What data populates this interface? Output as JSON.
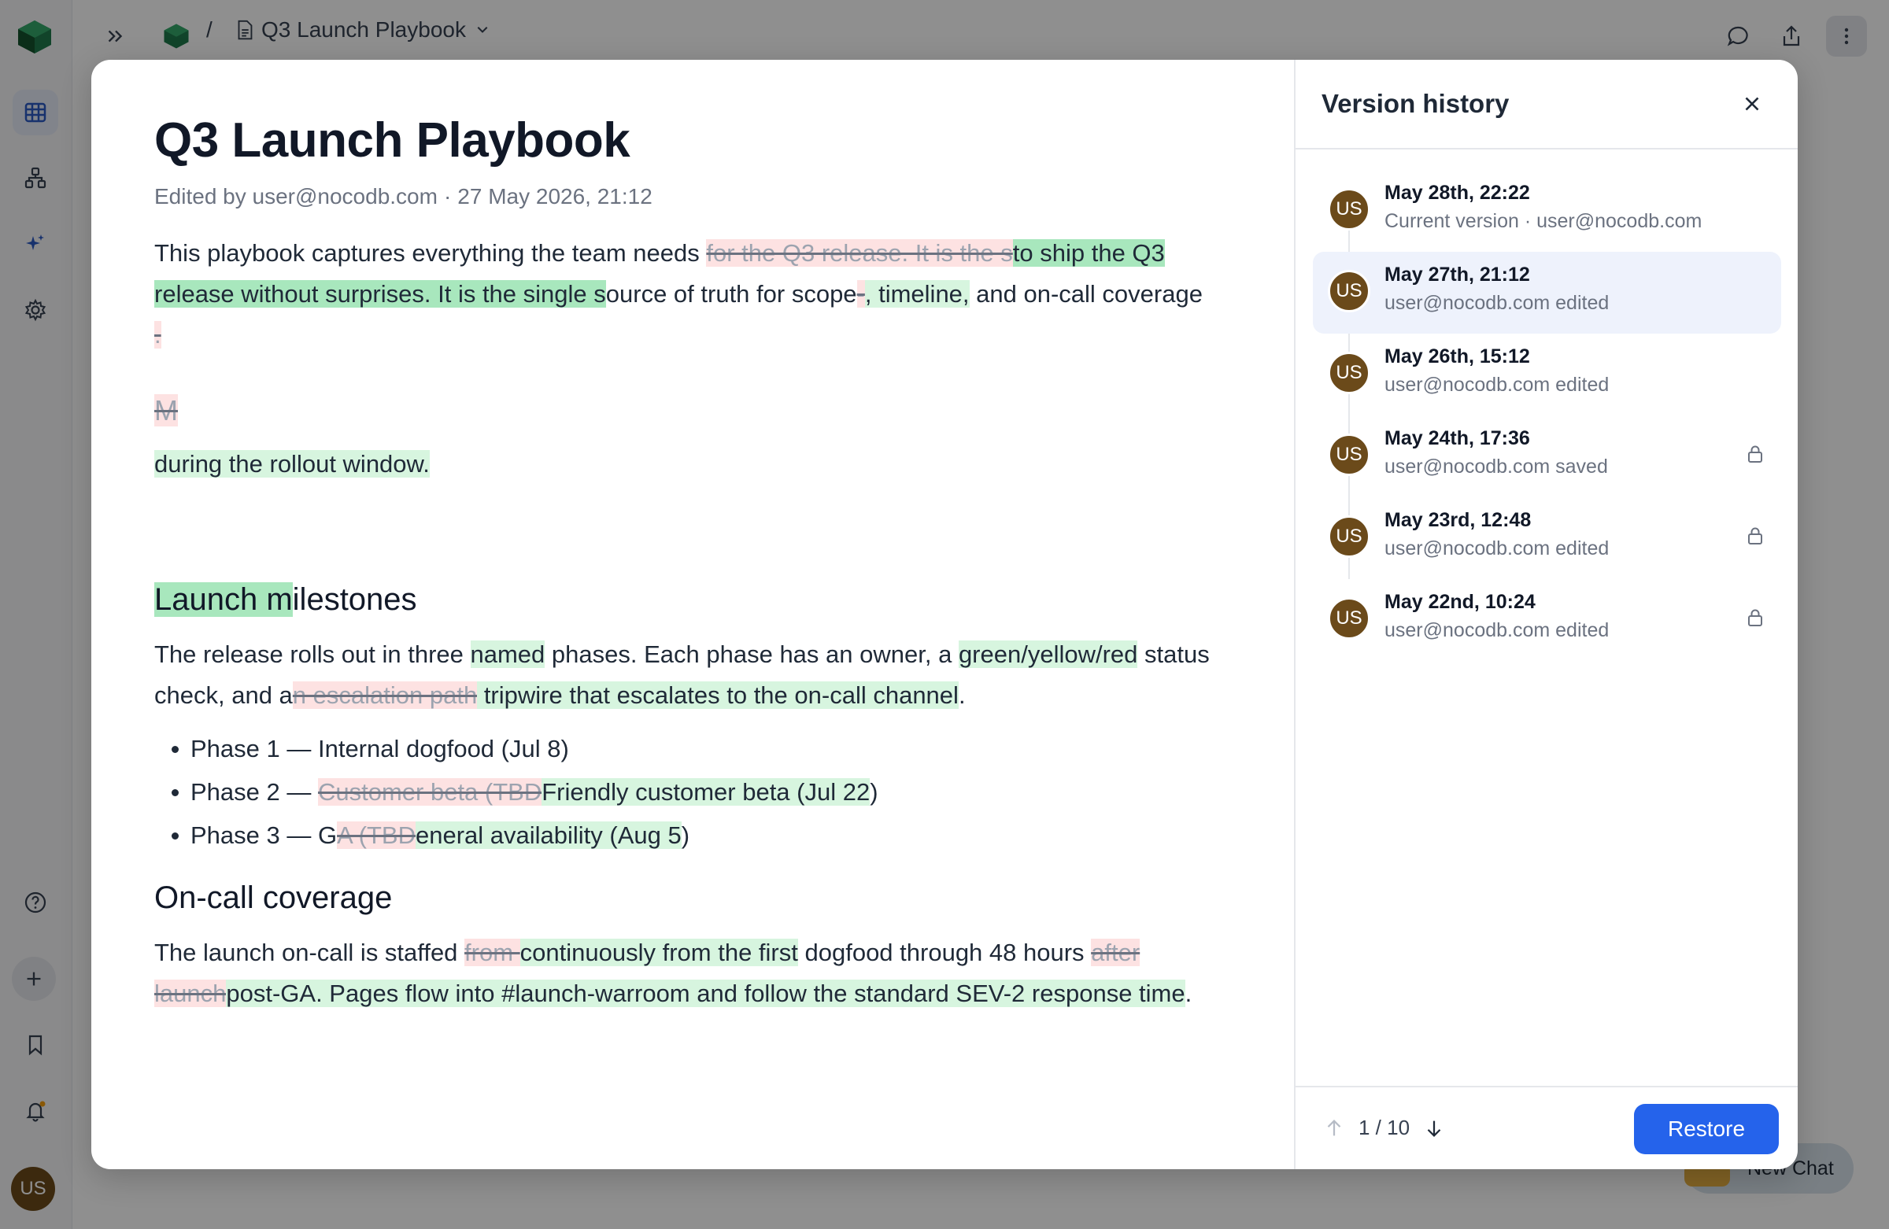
{
  "topbar": {
    "doc_title": "Q3 Launch Playbook",
    "separator": "/"
  },
  "rail": {
    "avatar_initials": "US"
  },
  "chat": {
    "label": "New Chat"
  },
  "doc": {
    "title": "Q3 Launch Playbook",
    "meta_editor": "Edited by user@nocodb.com",
    "meta_sep": "·",
    "meta_date": "27 May 2026, 21:12",
    "p1": {
      "a": "This playbook captures everything the team needs ",
      "del1": "for the Q3 release. It is the s",
      "ins1": "to ship the Q3 release without surprises. It is the single s",
      "b": "ource of truth for scope",
      "del2": "-",
      "ins2": ", timeline,",
      "c": " and on-call coverage"
    },
    "p2_del": ".",
    "p3_del": "M",
    "p4_ins": " during the rollout window.",
    "h_milestones_ins": "Launch m",
    "h_milestones_rest": "ilestones",
    "p5": {
      "a": "The release rolls out in three ",
      "ins1": "named",
      "b": " phases. Each phase has an owner, a ",
      "ins2": "green/yellow/red",
      "c": " status check, and a",
      "del1": "n escalation path",
      "ins3": " tripwire that escalates to the on-call channel",
      "d": "."
    },
    "bullets": [
      {
        "a": "Phase 1 — Internal dogfood (Jul 8)"
      },
      {
        "a": "Phase 2 — ",
        "del": "Customer beta (TBD",
        "ins": "Friendly customer beta (Jul 22",
        "b": ")"
      },
      {
        "a": "Phase 3 — G",
        "del": "A (TBD",
        "ins": "eneral availability (Aug 5",
        "b": ")"
      }
    ],
    "h_oncall": "On-call coverage",
    "p6": {
      "a": "The launch on-call is staffed ",
      "del1": "from ",
      "ins1": "continuously from the first",
      "b": " dogfood through 48 hours ",
      "del2": "after launch",
      "ins2": "post-GA. Pages flow into #launch-warroom and follow the standard SEV-2 response time",
      "c": "."
    }
  },
  "panel": {
    "title": "Version history",
    "versions": [
      {
        "date": "May 28th, 22:22",
        "sub": "Current version · user@nocodb.com",
        "initials": "US",
        "locked": false
      },
      {
        "date": "May 27th, 21:12",
        "sub": "user@nocodb.com edited",
        "initials": "US",
        "locked": false,
        "selected": true
      },
      {
        "date": "May 26th, 15:12",
        "sub": "user@nocodb.com edited",
        "initials": "US",
        "locked": false
      },
      {
        "date": "May 24th, 17:36",
        "sub": "user@nocodb.com saved",
        "initials": "US",
        "locked": true
      },
      {
        "date": "May 23rd, 12:48",
        "sub": "user@nocodb.com edited",
        "initials": "US",
        "locked": true
      },
      {
        "date": "May 22nd, 10:24",
        "sub": "user@nocodb.com edited",
        "initials": "US",
        "locked": true
      }
    ],
    "pager": "1 / 10",
    "restore_label": "Restore"
  },
  "colors": {
    "accent": "#2563eb",
    "insert_bg": "#d7f5df",
    "delete_bg": "#fde2e2",
    "avatar_bg": "#6b4a1a"
  }
}
